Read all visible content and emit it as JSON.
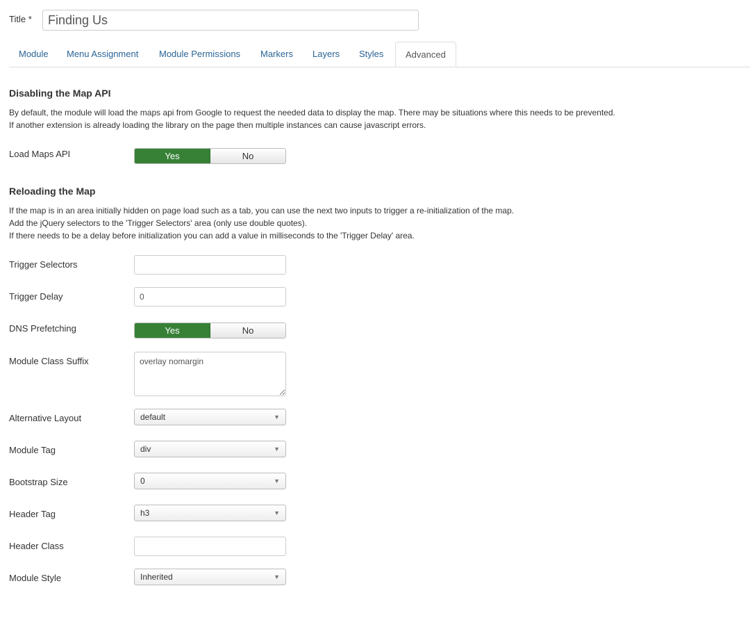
{
  "title": {
    "label": "Title *",
    "value": "Finding Us"
  },
  "tabs": [
    {
      "label": "Module"
    },
    {
      "label": "Menu Assignment"
    },
    {
      "label": "Module Permissions"
    },
    {
      "label": "Markers"
    },
    {
      "label": "Layers"
    },
    {
      "label": "Styles"
    },
    {
      "label": "Advanced"
    }
  ],
  "section1": {
    "heading": "Disabling the Map API",
    "lines": [
      "By default, the module will load the maps api from Google to request the needed data to display the map. There may be situations where this needs to be prevented.",
      "If another extension is already loading the library on the page then multiple instances can cause javascript errors."
    ]
  },
  "load_maps_api": {
    "label": "Load Maps API",
    "yes": "Yes",
    "no": "No",
    "selected": "Yes"
  },
  "section2": {
    "heading": "Reloading the Map",
    "lines": [
      "If the map is in an area initially hidden on page load such as a tab, you can use the next two inputs to trigger a re-initialization of the map.",
      "Add the jQuery selectors to the 'Trigger Selectors' area (only use double quotes).",
      "If there needs to be a delay before initialization you can add a value in milliseconds to the 'Trigger Delay' area."
    ]
  },
  "trigger_selectors": {
    "label": "Trigger Selectors",
    "value": ""
  },
  "trigger_delay": {
    "label": "Trigger Delay",
    "value": "0"
  },
  "dns_prefetching": {
    "label": "DNS Prefetching",
    "yes": "Yes",
    "no": "No",
    "selected": "Yes"
  },
  "module_class_suffix": {
    "label": "Module Class Suffix",
    "value": "overlay nomargin"
  },
  "alternative_layout": {
    "label": "Alternative Layout",
    "value": "default"
  },
  "module_tag": {
    "label": "Module Tag",
    "value": "div"
  },
  "bootstrap_size": {
    "label": "Bootstrap Size",
    "value": "0"
  },
  "header_tag": {
    "label": "Header Tag",
    "value": "h3"
  },
  "header_class": {
    "label": "Header Class",
    "value": ""
  },
  "module_style": {
    "label": "Module Style",
    "value": "Inherited"
  },
  "icons": {
    "select_arrow": "chevron-down-icon"
  },
  "colors": {
    "tab_link": "#2a6496",
    "toggle_on": "#378137"
  }
}
